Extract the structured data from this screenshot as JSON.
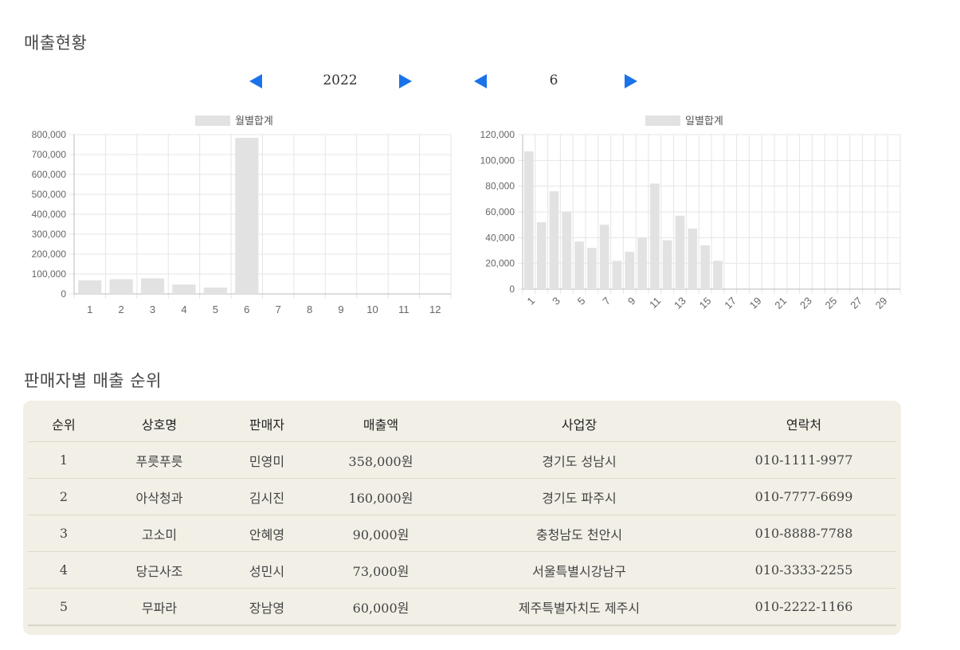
{
  "page": {
    "sales_title": "매출현황",
    "ranking_title": "판매자별 매출 순위"
  },
  "nav": {
    "year": "2022",
    "month": "6"
  },
  "colors": {
    "accent": "#1a73e8",
    "bar": "#e2e2e2",
    "grid": "#e5e5e5",
    "panel": "#f2efe6"
  },
  "chart_data": [
    {
      "type": "bar",
      "legend": "월별합계",
      "legend_position": "top",
      "categories": [
        "1",
        "2",
        "3",
        "4",
        "5",
        "6",
        "7",
        "8",
        "9",
        "10",
        "11",
        "12"
      ],
      "values": [
        68000,
        74000,
        78000,
        47000,
        32000,
        784000,
        0,
        0,
        0,
        0,
        0,
        0
      ],
      "ylim": [
        0,
        800000
      ],
      "yticks": [
        "0",
        "100,000",
        "200,000",
        "300,000",
        "400,000",
        "500,000",
        "600,000",
        "700,000",
        "800,000"
      ],
      "grid": true
    },
    {
      "type": "bar",
      "legend": "일별합계",
      "legend_position": "top",
      "categories": [
        "1",
        "2",
        "3",
        "4",
        "5",
        "6",
        "7",
        "8",
        "9",
        "10",
        "11",
        "12",
        "13",
        "14",
        "15",
        "16",
        "17",
        "18",
        "19",
        "20",
        "21",
        "22",
        "23",
        "24",
        "25",
        "26",
        "27",
        "28",
        "29",
        "30"
      ],
      "xtick_labels": [
        "1",
        "3",
        "5",
        "7",
        "9",
        "11",
        "13",
        "15",
        "17",
        "19",
        "21",
        "23",
        "25",
        "27",
        "29"
      ],
      "values": [
        107000,
        52000,
        76000,
        60000,
        37000,
        32000,
        50000,
        22000,
        29000,
        40000,
        82000,
        38000,
        57000,
        47000,
        34000,
        22000,
        0,
        0,
        0,
        0,
        0,
        0,
        0,
        0,
        0,
        0,
        0,
        0,
        0,
        0
      ],
      "ylim": [
        0,
        120000
      ],
      "yticks": [
        "0",
        "20,000",
        "40,000",
        "60,000",
        "80,000",
        "100,000",
        "120,000"
      ],
      "grid": true
    }
  ],
  "ranking": {
    "headers": [
      "순위",
      "상호명",
      "판매자",
      "매출액",
      "사업장",
      "연락처"
    ],
    "rows": [
      [
        "1",
        "푸릇푸릇",
        "민영미",
        "358,000원",
        "경기도 성남시",
        "010-1111-9977"
      ],
      [
        "2",
        "아삭청과",
        "김시진",
        "160,000원",
        "경기도 파주시",
        "010-7777-6699"
      ],
      [
        "3",
        "고소미",
        "안혜영",
        "90,000원",
        "충청남도 천안시",
        "010-8888-7788"
      ],
      [
        "4",
        "당근사조",
        "성민시",
        "73,000원",
        "서울특별시강남구",
        "010-3333-2255"
      ],
      [
        "5",
        "무파라",
        "장남영",
        "60,000원",
        "제주특별자치도 제주시",
        "010-2222-1166"
      ]
    ]
  }
}
